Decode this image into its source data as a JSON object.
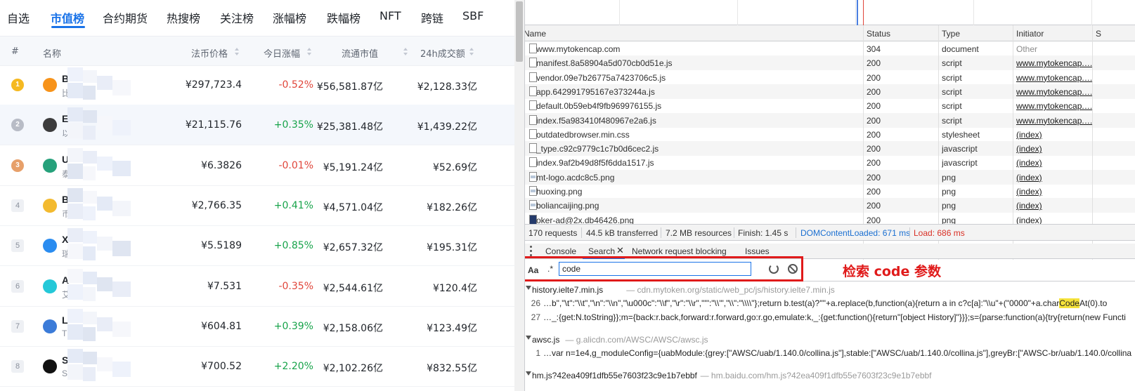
{
  "nav": {
    "items": [
      "自选",
      "市值榜",
      "合约期货",
      "热搜榜",
      "关注榜",
      "涨幅榜",
      "跌幅榜",
      "NFT",
      "跨链",
      "SBF"
    ],
    "active_index": 1
  },
  "table": {
    "headers": {
      "rank": "#",
      "name": "名称",
      "price": "法币价格",
      "change": "今日涨幅",
      "market_cap": "流通市值",
      "volume": "24h成交额"
    },
    "rows": [
      {
        "rank": "1",
        "symbol": "B",
        "name": "比",
        "price": "¥297,723.4",
        "change": "-0.52%",
        "market_cap": "¥56,581.87亿",
        "volume": "¥2,128.33亿",
        "coin_color": "#f7931a",
        "medal_color": "#f5b921",
        "icon": "bitcoin-icon"
      },
      {
        "rank": "2",
        "symbol": "E",
        "name": "以",
        "price": "¥21,115.76",
        "change": "+0.35%",
        "market_cap": "¥25,381.48亿",
        "volume": "¥1,439.22亿",
        "coin_color": "#3c3c3d",
        "medal_color": "#b8bcc6",
        "icon": "ethereum-icon"
      },
      {
        "rank": "3",
        "symbol": "U",
        "name": "泰",
        "price": "¥6.3826",
        "change": "-0.01%",
        "market_cap": "¥5,191.24亿",
        "volume": "¥52.69亿",
        "coin_color": "#26a17b",
        "medal_color": "#e7a06a",
        "icon": "tether-icon"
      },
      {
        "rank": "4",
        "symbol": "B",
        "name": "币",
        "price": "¥2,766.35",
        "change": "+0.41%",
        "market_cap": "¥4,571.04亿",
        "volume": "¥182.26亿",
        "coin_color": "#f3ba2f",
        "icon": "bnb-icon"
      },
      {
        "rank": "5",
        "symbol": "X",
        "name": "瑞",
        "price": "¥5.5189",
        "change": "+0.85%",
        "market_cap": "¥2,657.32亿",
        "volume": "¥195.31亿",
        "coin_color": "#2a8cf0",
        "icon": "xrp-icon"
      },
      {
        "rank": "6",
        "symbol": "A",
        "name": "艾",
        "price": "¥7.531",
        "change": "-0.35%",
        "market_cap": "¥2,544.61亿",
        "volume": "¥120.4亿",
        "coin_color": "#24c8d8",
        "icon": "cardano-icon"
      },
      {
        "rank": "7",
        "symbol": "L",
        "name": "T",
        "price": "¥604.81",
        "change": "+0.39%",
        "market_cap": "¥2,158.06亿",
        "volume": "¥123.49亿",
        "coin_color": "#3b7bd8",
        "icon": "globe-icon"
      },
      {
        "rank": "8",
        "symbol": "S",
        "name": "S",
        "price": "¥700.52",
        "change": "+2.20%",
        "market_cap": "¥2,102.26亿",
        "volume": "¥832.55亿",
        "coin_color": "#111111",
        "icon": "solana-icon"
      }
    ]
  },
  "devtools": {
    "network_headers": {
      "name": "Name",
      "status": "Status",
      "type": "Type",
      "initiator": "Initiator",
      "size": "S"
    },
    "requests": [
      {
        "name": "www.mytokencap.com",
        "status": "304",
        "type": "document",
        "initiator": "Other",
        "initiator_link": false,
        "icon": "doc"
      },
      {
        "name": "manifest.8a58904a5d070cb0d51e.js",
        "status": "200",
        "type": "script",
        "initiator": "www.mytokencap.…",
        "initiator_link": true,
        "icon": "doc"
      },
      {
        "name": "vendor.09e7b26775a7423706c5.js",
        "status": "200",
        "type": "script",
        "initiator": "www.mytokencap.…",
        "initiator_link": true,
        "icon": "doc"
      },
      {
        "name": "app.642991795167e373244a.js",
        "status": "200",
        "type": "script",
        "initiator": "www.mytokencap.…",
        "initiator_link": true,
        "icon": "doc"
      },
      {
        "name": "default.0b59eb4f9fb969976155.js",
        "status": "200",
        "type": "script",
        "initiator": "www.mytokencap.…",
        "initiator_link": true,
        "icon": "doc"
      },
      {
        "name": "index.f5a983410f480967e2a6.js",
        "status": "200",
        "type": "script",
        "initiator": "www.mytokencap.…",
        "initiator_link": true,
        "icon": "doc"
      },
      {
        "name": "outdatedbrowser.min.css",
        "status": "200",
        "type": "stylesheet",
        "initiator": "(index)",
        "initiator_link": true,
        "icon": "doc"
      },
      {
        "name": "_type.c92c9779c1c7b0d6cec2.js",
        "status": "200",
        "type": "javascript",
        "initiator": "(index)",
        "initiator_link": true,
        "icon": "doc"
      },
      {
        "name": "index.9af2b49d8f5f6dda1517.js",
        "status": "200",
        "type": "javascript",
        "initiator": "(index)",
        "initiator_link": true,
        "icon": "doc"
      },
      {
        "name": "mt-logo.acdc8c5.png",
        "status": "200",
        "type": "png",
        "initiator": "(index)",
        "initiator_link": true,
        "icon": "img"
      },
      {
        "name": "huoxing.png",
        "status": "200",
        "type": "png",
        "initiator": "(index)",
        "initiator_link": true,
        "icon": "img"
      },
      {
        "name": "boliancaijing.png",
        "status": "200",
        "type": "png",
        "initiator": "(index)",
        "initiator_link": true,
        "icon": "img"
      },
      {
        "name": "oker-ad@2x.db46426.png",
        "status": "200",
        "type": "png",
        "initiator": "(index)",
        "initiator_link": true,
        "icon": "dark"
      }
    ],
    "summary": {
      "requests": "170 requests",
      "transferred": "44.5 kB transferred",
      "resources": "7.2 MB resources",
      "finish": "Finish: 1.45 s",
      "dom_content_loaded": "DOMContentLoaded: 671 ms",
      "load": "Load: 686 ms"
    },
    "drawer_tabs": [
      "Console",
      "Search",
      "Network request blocking",
      "Issues"
    ],
    "active_drawer_tab": "Search",
    "search": {
      "match_case_label": "Aa",
      "regex_label": ".*",
      "query": "code"
    },
    "annotation": "检索 code 参数",
    "results": [
      {
        "file": "history.ielte7.min.js",
        "url": "— cdn.mytoken.org/static/web_pc/js/history.ielte7.min.js",
        "lines": [
          {
            "num": "26",
            "before": "…b\",\"\\t\":\"\\\\t\",\"\\n\":\"\\\\n\",\"\\u000c\":\"\\\\f\",\"\\r\":\"\\\\r\",\"'\":\"\\\\'\",\"\\\\\":\"\\\\\\\\\"};return b.test(a)?'\"'+a.replace(b,function(a){return a in c?c[a]:\"\\\\u\"+(\"0000\"+a.char",
            "match": "Code",
            "after": "At(0).to"
          },
          {
            "num": "27",
            "before": "…_:{get:N.toString}};m={back:r.back,forward:r.forward,go:r.go,emulate:k,_:{get:function(){return\"[object History]\"}}};s={parse:function(a){try{return(new Functi",
            "match": "",
            "after": ""
          }
        ]
      },
      {
        "file": "awsc.js",
        "url": "— g.alicdn.com/AWSC/AWSC/awsc.js",
        "lines": [
          {
            "num": "1",
            "before": "…var n=1e4,g_moduleConfig={uabModule:{grey:[\"AWSC/uab/1.140.0/collina.js\"],stable:[\"AWSC/uab/1.140.0/collina.js\"],greyBr:[\"AWSC-br/uab/1.140.0/collina",
            "match": "",
            "after": ""
          }
        ]
      },
      {
        "file": "hm.js?42ea409f1dfb55e7603f23c9e1b7ebbf",
        "url": "— hm.baidu.com/hm.js?42ea409f1dfb55e7603f23c9e1b7ebbf",
        "lines": []
      }
    ]
  }
}
